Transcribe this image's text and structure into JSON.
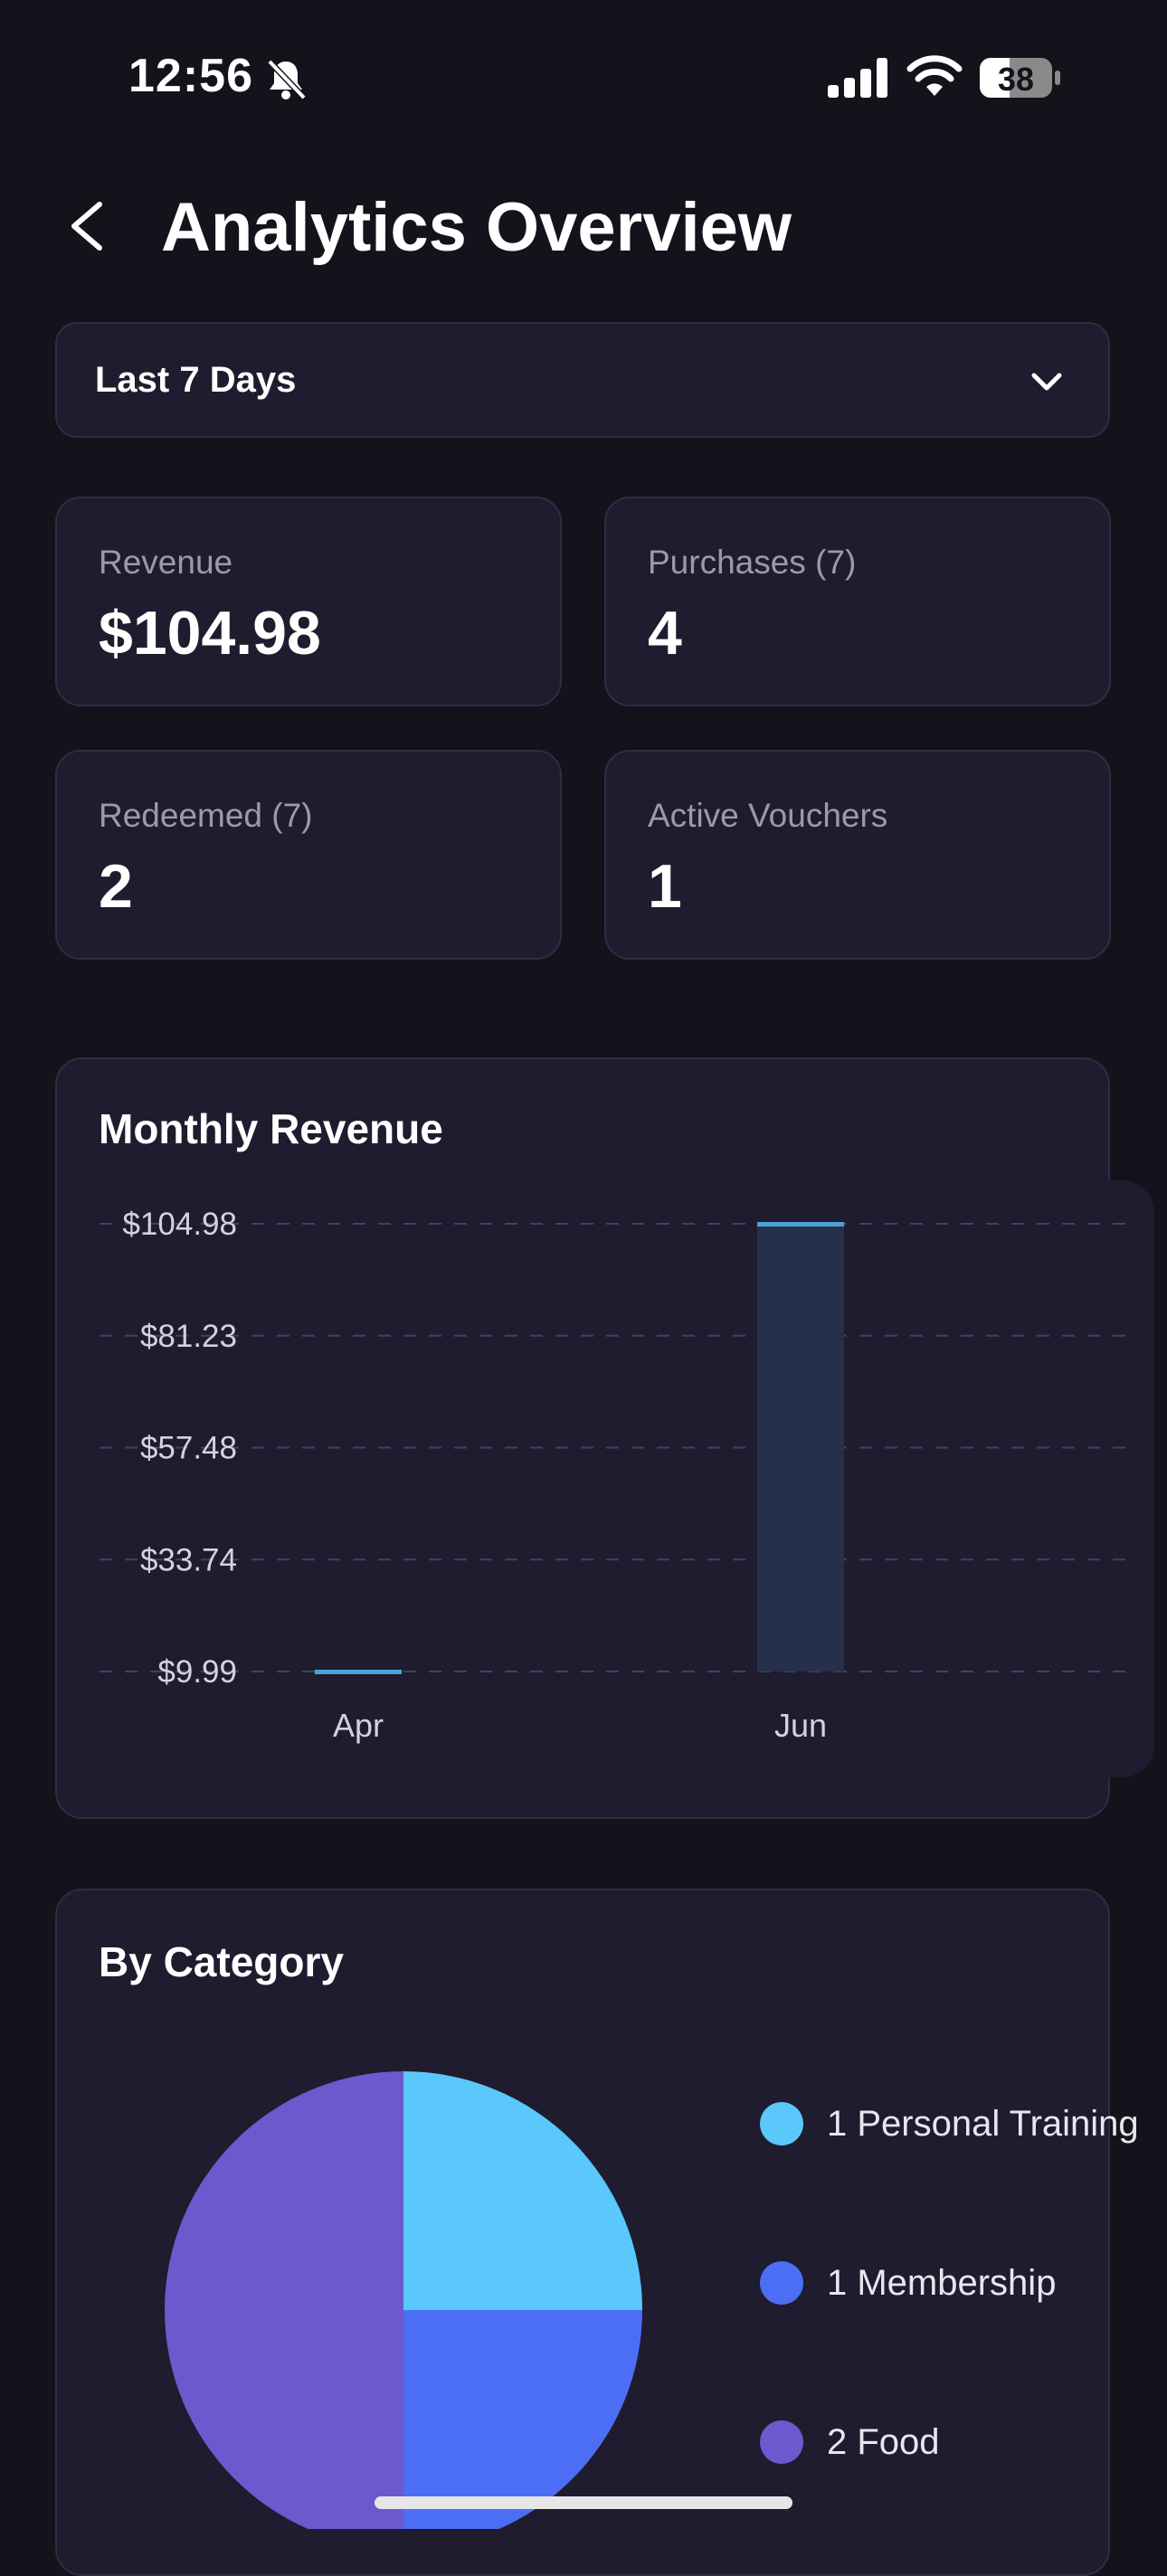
{
  "status": {
    "time": "12:56",
    "battery": "38"
  },
  "header": {
    "title": "Analytics Overview"
  },
  "range": {
    "selected": "Last 7 Days"
  },
  "stats": [
    {
      "label": "Revenue",
      "value": "$104.98"
    },
    {
      "label": "Purchases (7)",
      "value": "4"
    },
    {
      "label": "Redeemed (7)",
      "value": "2"
    },
    {
      "label": "Active Vouchers",
      "value": "1"
    }
  ],
  "monthly": {
    "title": "Monthly Revenue"
  },
  "category": {
    "title": "By Category",
    "legend": [
      {
        "label": "1 Personal Training",
        "color": "#5ac8fa"
      },
      {
        "label": "1 Membership",
        "color": "#4c6ef5"
      },
      {
        "label": "2 Food",
        "color": "#6a5acd"
      }
    ]
  },
  "chart_data": [
    {
      "type": "bar",
      "title": "Monthly Revenue",
      "categories": [
        "Apr",
        "Jun"
      ],
      "values": [
        9.99,
        104.98
      ],
      "yticks": [
        "$104.98",
        "$81.23",
        "$57.48",
        "$33.74",
        "$9.99"
      ],
      "ylim": [
        9.99,
        104.98
      ],
      "grid": true,
      "colors": {
        "bar": "#27304a",
        "bar_top": "#4aa3d8"
      }
    },
    {
      "type": "pie",
      "title": "By Category",
      "categories": [
        "Personal Training",
        "Membership",
        "Food"
      ],
      "values": [
        1,
        1,
        2
      ],
      "colors": [
        "#5ac8fa",
        "#4c6ef5",
        "#6a5acd"
      ],
      "legend": "right"
    }
  ]
}
